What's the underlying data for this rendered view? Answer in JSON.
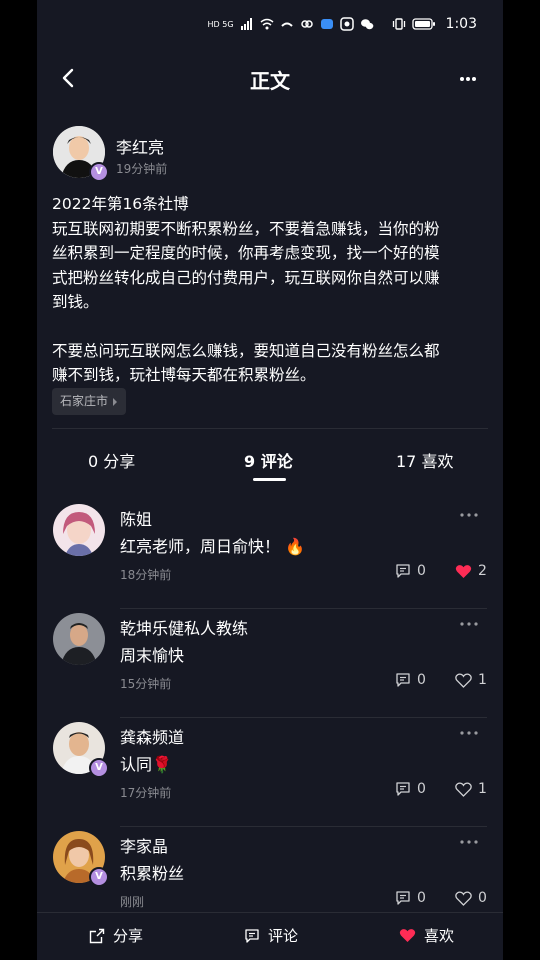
{
  "status_bar": {
    "time": "1:03",
    "network": "HD 5G"
  },
  "nav": {
    "title": "正文"
  },
  "post": {
    "author_name": "李红亮",
    "author_time": "19分钟前",
    "verified_badge": "V",
    "lines": [
      "2022年第16条社博",
      "玩互联网初期要不断积累粉丝，不要着急赚钱，当你的粉",
      "丝积累到一定程度的时候，你再考虑变现，找一个好的模",
      "式把粉丝转化成自己的付费用户，玩互联网你自然可以赚",
      "到钱。"
    ],
    "lines2": [
      "不要总问玩互联网怎么赚钱，要知道自己没有粉丝怎么都",
      "赚不到钱，玩社博每天都在积累粉丝。"
    ],
    "location": "石家庄市"
  },
  "tabs": {
    "share": "0 分享",
    "comments": "9 评论",
    "likes": "17 喜欢"
  },
  "comments": [
    {
      "name": "陈姐",
      "text": "红亮老师，周日俞快！ 🔥",
      "time": "18分钟前",
      "replies": "0",
      "likes": "2",
      "liked": true,
      "avatar_color": "#c98fa3",
      "verified": false
    },
    {
      "name": "乾坤乐健私人教练",
      "text": "周末愉快",
      "time": "15分钟前",
      "replies": "0",
      "likes": "1",
      "liked": false,
      "avatar_color": "#5a5e66",
      "verified": false
    },
    {
      "name": "龚森频道",
      "text": "认同🌹",
      "time": "17分钟前",
      "replies": "0",
      "likes": "1",
      "liked": false,
      "avatar_color": "#d9c8b8",
      "verified": true
    },
    {
      "name": "李家晶",
      "text": "积累粉丝",
      "time": "刚刚",
      "replies": "0",
      "likes": "0",
      "liked": false,
      "avatar_color": "#c98a3a",
      "verified": true
    }
  ],
  "bottom_bar": {
    "share": "分享",
    "comment": "评论",
    "like": "喜欢"
  },
  "colors": {
    "background": "#161823",
    "like_red": "#fe2c55",
    "muted": "#8a8b91",
    "badge": "#b48fe0"
  }
}
